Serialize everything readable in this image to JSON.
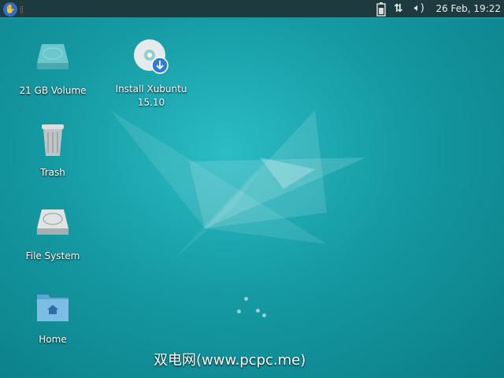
{
  "panel": {
    "clock": "26 Feb, 19:22",
    "icons": [
      "xubuntu-menu-icon",
      "battery-icon",
      "network-icon",
      "volume-icon"
    ]
  },
  "desktop": {
    "icons": [
      {
        "label": "21 GB Volume",
        "icon": "drive-icon"
      },
      {
        "label": "Install Xubuntu 15.10",
        "icon": "cd-install-icon"
      },
      {
        "label": "Trash",
        "icon": "trash-icon"
      },
      {
        "label": "File System",
        "icon": "harddisk-icon"
      },
      {
        "label": "Home",
        "icon": "home-folder-icon"
      }
    ]
  },
  "watermark": "双电网(www.pcpc.me)"
}
